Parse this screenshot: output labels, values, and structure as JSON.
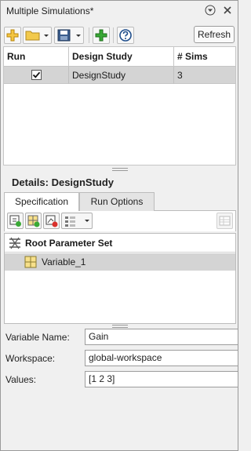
{
  "title": "Multiple Simulations*",
  "toolbar": {
    "refresh_label": "Refresh"
  },
  "table": {
    "columns": [
      "Run",
      "Design Study",
      "# Sims"
    ],
    "rows": [
      {
        "run_checked": true,
        "design_study": "DesignStudy",
        "sims": "3"
      }
    ]
  },
  "details": {
    "title": "Details: DesignStudy",
    "tabs": [
      "Specification",
      "Run Options"
    ],
    "tree": {
      "root": "Root Parameter Set",
      "children": [
        "Variable_1"
      ]
    },
    "form": {
      "variable_name_label": "Variable Name:",
      "variable_name_value": "Gain",
      "workspace_label": "Workspace:",
      "workspace_value": "global-workspace",
      "values_label": "Values:",
      "values_value": "[1 2 3]"
    }
  },
  "colors": {
    "selection": "#d4d4d4",
    "add_green": "#39a935",
    "folder_yellow": "#f2c94c",
    "save_blue": "#3a5c8c"
  }
}
